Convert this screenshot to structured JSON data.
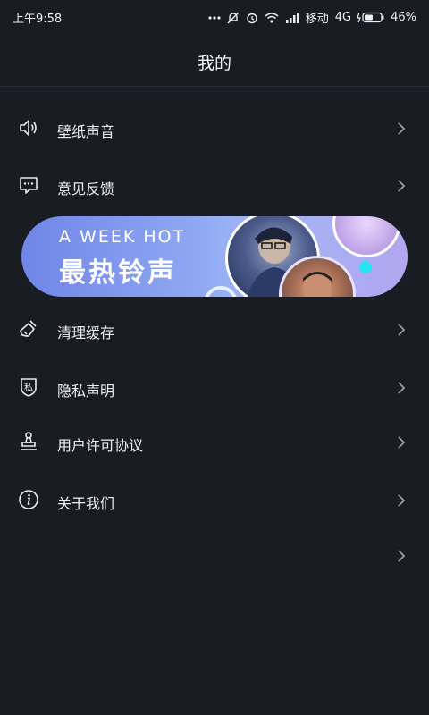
{
  "status_bar": {
    "time": "上午9:58",
    "carrier": "移动",
    "network": "4G",
    "battery": "46%"
  },
  "header": {
    "title": "我的"
  },
  "menu": [
    {
      "label": "壁纸声音",
      "icon": "speaker-icon"
    },
    {
      "label": "意见反馈",
      "icon": "feedback-icon"
    },
    {
      "label": "清理缓存",
      "icon": "broom-icon"
    },
    {
      "label": "隐私声明",
      "icon": "privacy-shield-icon"
    },
    {
      "label": "用户许可协议",
      "icon": "stamp-icon"
    },
    {
      "label": "关于我们",
      "icon": "info-icon"
    }
  ],
  "banner": {
    "subtitle": "A WEEK HOT",
    "title": "最热铃声",
    "shield_char": "私"
  },
  "colors": {
    "background": "#1a1c24",
    "accent_cyan": "#28e4f0",
    "banner_gradient_start": "#6f86e8",
    "banner_gradient_end": "#b3a6f0"
  }
}
